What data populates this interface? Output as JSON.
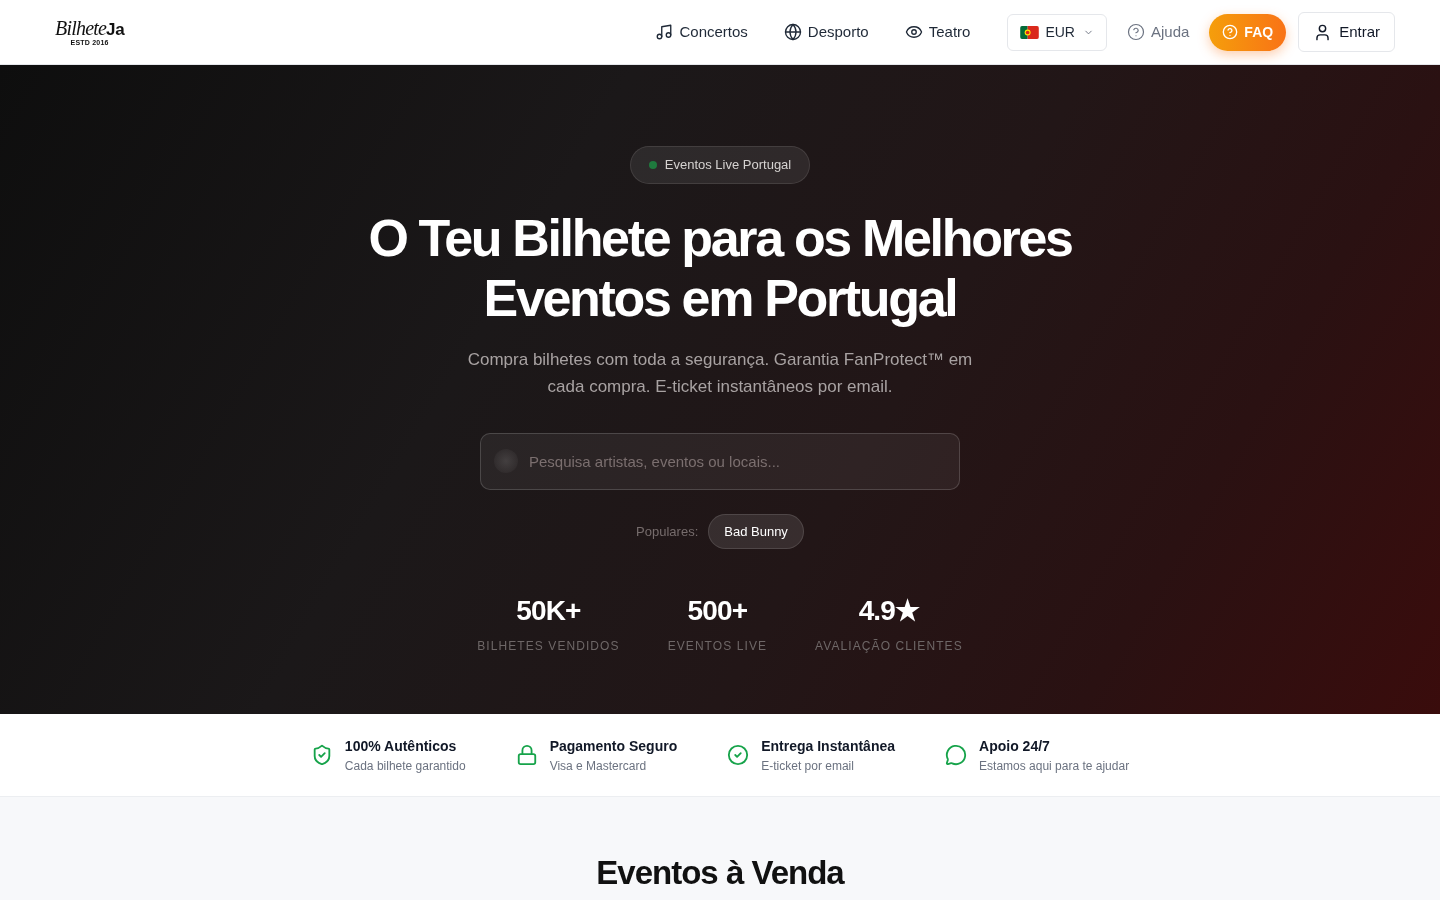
{
  "header": {
    "logo": {
      "script": "Bilhete",
      "bold": "Ja",
      "tagline": "ESTD 2016"
    },
    "nav": [
      {
        "kind": "music",
        "label": "Concertos"
      },
      {
        "kind": "globe",
        "label": "Desporto"
      },
      {
        "kind": "eye",
        "label": "Teatro"
      }
    ],
    "currency": {
      "code": "EUR"
    },
    "help": {
      "label": "Ajuda"
    },
    "faq": {
      "label": "FAQ"
    },
    "login": {
      "label": "Entrar"
    }
  },
  "hero": {
    "badge": "Eventos Live Portugal",
    "title": "O Teu Bilhete para os Melhores Eventos em Portugal",
    "subtitle": "Compra bilhetes com toda a segurança. Garantia FanProtect™ em cada compra. E-ticket instantâneos por email.",
    "search": {
      "placeholder": "Pesquisa artistas, eventos ou locais..."
    },
    "popular": {
      "label": "Populares:",
      "tags": [
        "Bad Bunny"
      ]
    },
    "stats": [
      {
        "value": "50K+",
        "label": "BILHETES VENDIDOS"
      },
      {
        "value": "500+",
        "label": "EVENTOS LIVE"
      },
      {
        "value": "4.9★",
        "label": "AVALIAÇÃO CLIENTES"
      }
    ]
  },
  "features": [
    {
      "kind": "shield",
      "title": "100% Autênticos",
      "subtitle": "Cada bilhete garantido"
    },
    {
      "kind": "lock",
      "title": "Pagamento Seguro",
      "subtitle": "Visa e Mastercard"
    },
    {
      "kind": "check",
      "title": "Entrega Instantânea",
      "subtitle": "E-ticket por email"
    },
    {
      "kind": "chat",
      "title": "Apoio 24/7",
      "subtitle": "Estamos aqui para te ajudar"
    }
  ],
  "events_section": {
    "title": "Eventos à Venda"
  }
}
